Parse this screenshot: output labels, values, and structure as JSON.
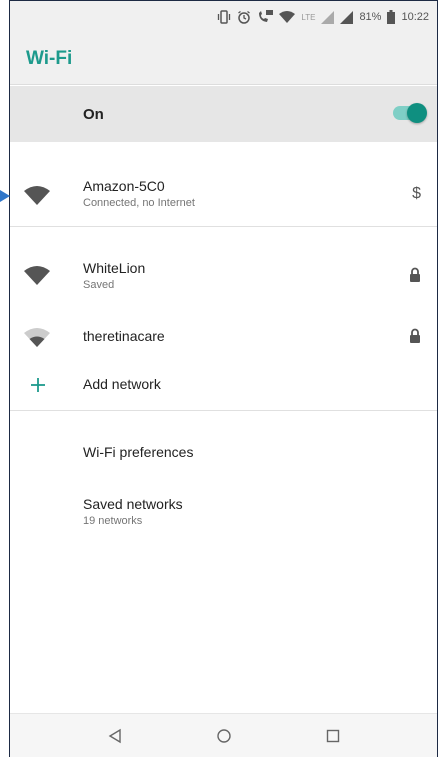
{
  "status_bar": {
    "icons": [
      "vibrate-icon",
      "alarm-icon",
      "lte-call-icon",
      "wifi-call-icon",
      "lte-signal-icon",
      "signal-icon",
      "battery-icon"
    ],
    "lte_label": "LTE",
    "battery_percent": "81%",
    "time": "10:22"
  },
  "app_bar": {
    "title": "Wi-Fi"
  },
  "master_switch": {
    "label": "On",
    "state": "on",
    "color": "#0f8f80"
  },
  "connected_network": {
    "name": "Amazon-5C0",
    "status": "Connected, no Internet",
    "trailing_symbol": "$",
    "signal_icon": "wifi-full-icon"
  },
  "networks": [
    {
      "name": "WhiteLion",
      "status": "Saved",
      "secure": true,
      "signal_icon": "wifi-full-icon"
    },
    {
      "name": "theretinacare",
      "status": "",
      "secure": true,
      "signal_icon": "wifi-weak-icon"
    }
  ],
  "add_network": {
    "label": "Add network",
    "icon": "plus-icon",
    "color": "#1d9a8c"
  },
  "preferences": {
    "label": "Wi-Fi preferences"
  },
  "saved_networks": {
    "label": "Saved networks",
    "count_text": "19 networks"
  },
  "nav_bar": {
    "icons": [
      "back-icon",
      "home-icon",
      "recents-icon"
    ]
  },
  "colors": {
    "accent": "#1d9a8c",
    "header_bg": "#f0f0f0",
    "master_bg": "#e6e6e6"
  }
}
